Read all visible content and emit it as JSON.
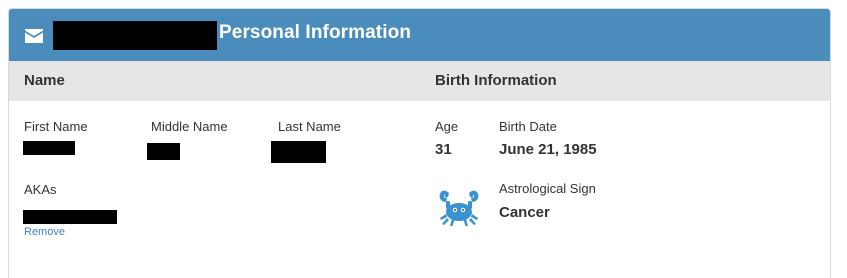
{
  "header": {
    "title": "Personal Information",
    "icon": "mail-icon",
    "color": "#4a8dbd"
  },
  "sections": {
    "name_title": "Name",
    "birth_title": "Birth Information"
  },
  "name": {
    "first_label": "First Name",
    "middle_label": "Middle Name",
    "last_label": "Last Name",
    "akas_label": "AKAs",
    "remove_label": "Remove"
  },
  "birth": {
    "age_label": "Age",
    "age_value": "31",
    "date_label": "Birth Date",
    "date_value": "June 21, 1985",
    "sign_label": "Astrological Sign",
    "sign_value": "Cancer",
    "sign_icon": "crab-icon"
  },
  "colors": {
    "accent": "#4a8dbd",
    "section_bg": "#e6e6e6",
    "link": "#3a85c0"
  }
}
